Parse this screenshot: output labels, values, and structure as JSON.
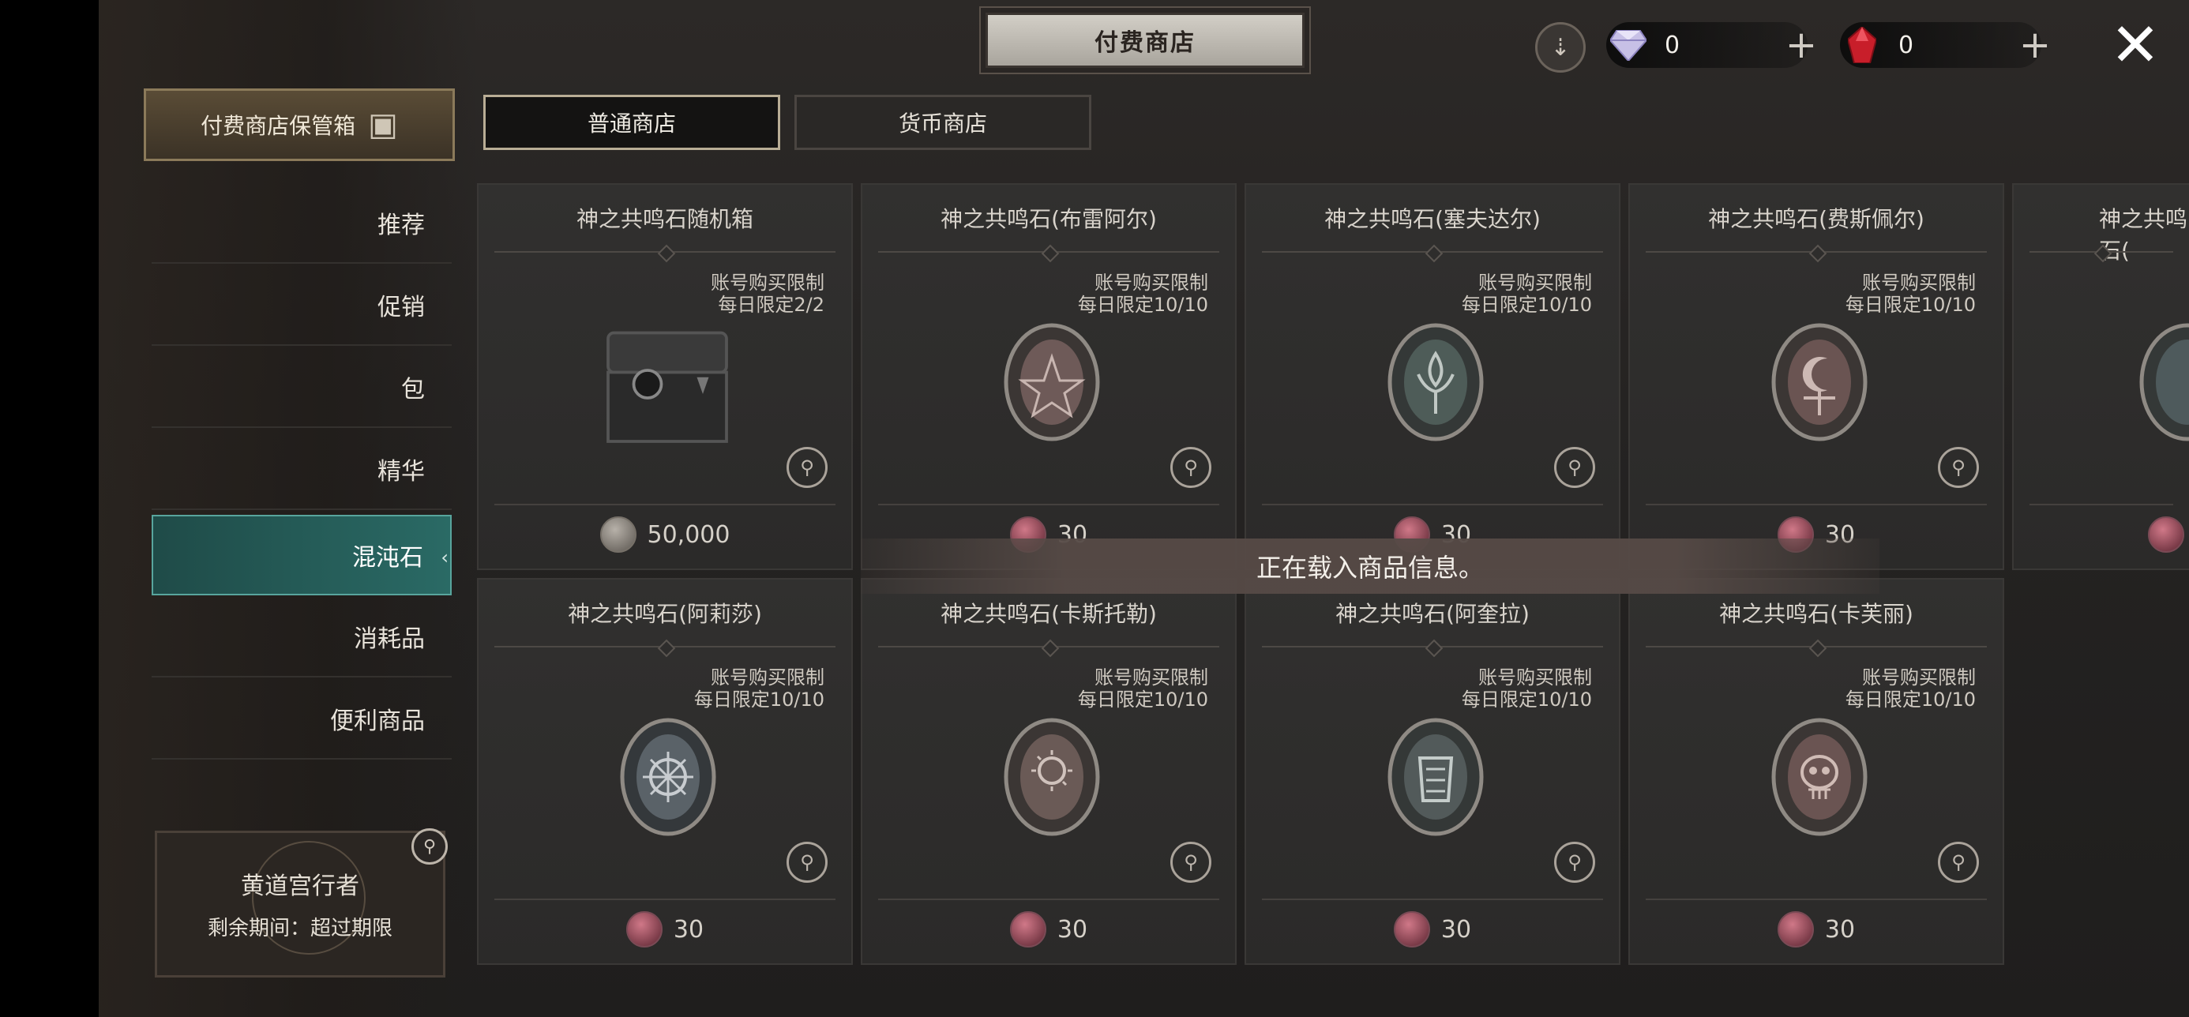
{
  "title": "付费商店",
  "currency": [
    {
      "name": "diamond",
      "value": "0",
      "color": "#c9c3e8"
    },
    {
      "name": "ruby",
      "value": "0",
      "color": "#c81e2a"
    }
  ],
  "storage_button": "付费商店保管箱",
  "tabs": [
    {
      "label": "普通商店",
      "active": true
    },
    {
      "label": "货币商店",
      "active": false
    }
  ],
  "sidebar": {
    "items": [
      {
        "label": "推荐"
      },
      {
        "label": "促销"
      },
      {
        "label": "包"
      },
      {
        "label": "精华"
      },
      {
        "label": "混沌石",
        "active": true
      },
      {
        "label": "消耗品"
      },
      {
        "label": "便利商品"
      }
    ]
  },
  "pass": {
    "name": "黄道宫行者",
    "period": "剩余期间：超过期限"
  },
  "loading_text": "正在载入商品信息。",
  "products": [
    {
      "name": "神之共鸣石随机箱",
      "limit_type": "账号购买限制",
      "limit": "每日限定2/2",
      "price": "50,000",
      "currency": "silver",
      "icon": "chest-icon"
    },
    {
      "name": "神之共鸣石(布雷阿尔)",
      "limit_type": "账号购买限制",
      "limit": "每日限定10/10",
      "price": "30",
      "currency": "ruby",
      "icon": "pentagram-stone-icon"
    },
    {
      "name": "神之共鸣石(塞夫达尔)",
      "limit_type": "账号购买限制",
      "limit": "每日限定10/10",
      "price": "30",
      "currency": "ruby",
      "icon": "fleur-stone-icon"
    },
    {
      "name": "神之共鸣石(费斯佩尔)",
      "limit_type": "账号购买限制",
      "limit": "每日限定10/10",
      "price": "30",
      "currency": "ruby",
      "icon": "moon-stone-icon"
    },
    {
      "name": "神之共鸣石(阿莉莎)",
      "limit_type": "账号购买限制",
      "limit": "每日限定10/10",
      "price": "30",
      "currency": "ruby",
      "icon": "star-stone-icon"
    },
    {
      "name": "神之共鸣石(卡斯托勒)",
      "limit_type": "账号购买限制",
      "limit": "每日限定10/10",
      "price": "30",
      "currency": "ruby",
      "icon": "sun-stone-icon"
    },
    {
      "name": "神之共鸣石(阿奎拉)",
      "limit_type": "账号购买限制",
      "limit": "每日限定10/10",
      "price": "30",
      "currency": "ruby",
      "icon": "wing-stone-icon"
    },
    {
      "name": "神之共鸣石(卡芙丽)",
      "limit_type": "账号购买限制",
      "limit": "每日限定10/10",
      "price": "30",
      "currency": "ruby",
      "icon": "skull-stone-icon"
    }
  ],
  "partial_card": {
    "name": "神之共鸣石(",
    "icon": "stone-icon"
  }
}
